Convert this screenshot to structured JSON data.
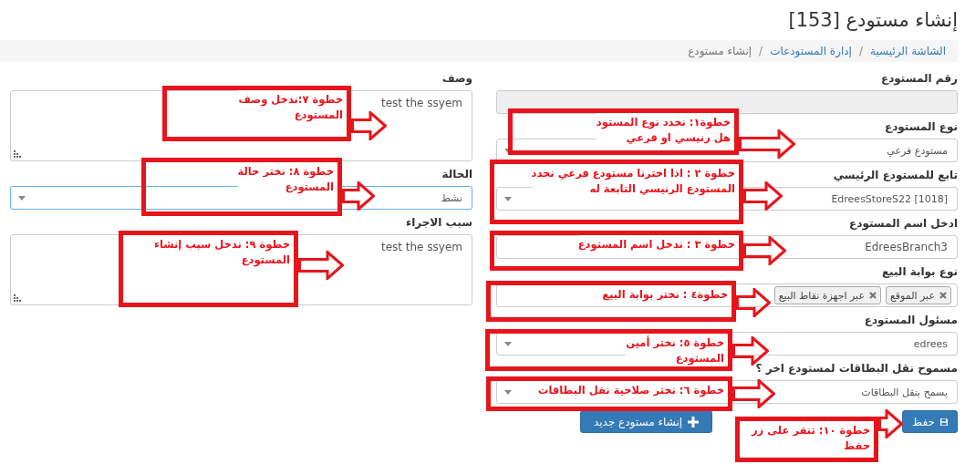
{
  "page_title": "إنشاء مستودع [153]",
  "breadcrumb": [
    {
      "kind": "link",
      "label": "الشاشة الرئيسية"
    },
    {
      "kind": "separator",
      "label": "/"
    },
    {
      "kind": "link",
      "label": "إدارة المستودعات"
    },
    {
      "kind": "separator",
      "label": "/"
    },
    {
      "kind": "current",
      "label": "إنشاء مستودع"
    }
  ],
  "right_fields": [
    {
      "kind": "input",
      "label": "رقم المستودع",
      "disabled": true
    },
    {
      "kind": "select",
      "label": "نوع المستودع",
      "value": "مستودع فرعي",
      "focused": false
    },
    {
      "kind": "select",
      "label": "تابع للمستودع الرئيسي",
      "value": "EdreesStoreS22 [1018]",
      "focused": false
    },
    {
      "kind": "input",
      "label": "ادخل اسم المستودع",
      "value": "EdreesBranch3",
      "disabled": false
    },
    {
      "kind": "tags",
      "label": "نوع بوابة البيع",
      "tags": [
        "عبر الموقع",
        "عبر اجهزة نقاط البيع"
      ]
    },
    {
      "kind": "select",
      "label": "مسئول المستودع",
      "value": "edrees",
      "focused": false
    },
    {
      "kind": "select",
      "label": "مسموح نقل البطاقات لمستودع اخر ؟",
      "value": "يسمح بنقل البطاقات",
      "focused": false
    }
  ],
  "left_fields": [
    {
      "kind": "textarea",
      "label": "وصف",
      "value": "test the ssyem"
    },
    {
      "kind": "select",
      "label": "الحالة",
      "value": "نشط",
      "focused": true
    },
    {
      "kind": "textarea",
      "label": "سبب الاجراء",
      "value": "test the ssyem"
    }
  ],
  "buttons": [
    {
      "kind": "save",
      "label": "حفظ"
    },
    {
      "kind": "new",
      "label": "إنشاء مستودع جديد"
    }
  ],
  "annotations": [
    {
      "lines": [
        "خطوة١: نحدد نوع المستود",
        "هل رنيسي او فرعي"
      ]
    },
    {
      "lines": [
        "خطوة ٢ : اذا اخترنا مستودع فرعي نحدد",
        "المستودع الرنيسي التابعة له"
      ]
    },
    {
      "lines": [
        "خطوة ٣ : ندخل اسم المستودع"
      ]
    },
    {
      "lines": [
        "خطوة٤ : نختر بوابة البيع"
      ]
    },
    {
      "lines": [
        "خطوة ٥: نختر أمين",
        "المستودع"
      ]
    },
    {
      "lines": [
        "خطوة ٦: نختر صلاحية نقل البطاقات"
      ]
    },
    {
      "lines": [
        "خطوة ٧:ندخل وصف",
        "المستودع"
      ]
    },
    {
      "lines": [
        "خطوة ٨: نختر حالة",
        "المستودع"
      ]
    },
    {
      "lines": [
        "خطوة ٩: ندخل سبب إنشاء",
        "المستودع"
      ]
    },
    {
      "lines": [
        "خطوة ١٠: تنقر على زر",
        "حفظ"
      ]
    }
  ]
}
